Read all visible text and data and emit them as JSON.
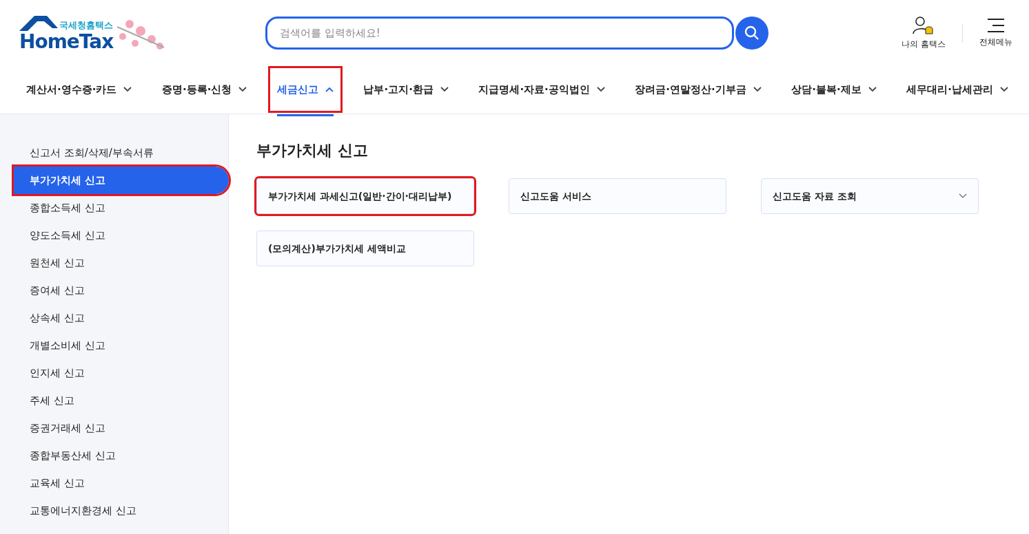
{
  "logo": {
    "subtitle": "국세청홈택스",
    "name": "HomeTax"
  },
  "search": {
    "placeholder": "검색어를 입력하세요!"
  },
  "utility": [
    {
      "kind": "my",
      "label": "나의 홈택스"
    },
    {
      "kind": "menu",
      "label": "전체메뉴"
    }
  ],
  "nav": [
    {
      "label": "계산서·영수증·카드",
      "selected": false,
      "highlighted": false
    },
    {
      "label": "증명·등록·신청",
      "selected": false,
      "highlighted": false
    },
    {
      "label": "세금신고",
      "selected": true,
      "highlighted": true
    },
    {
      "label": "납부·고지·환급",
      "selected": false,
      "highlighted": false
    },
    {
      "label": "지급명세·자료·공익법인",
      "selected": false,
      "highlighted": false
    },
    {
      "label": "장려금·연말정산·기부금",
      "selected": false,
      "highlighted": false
    },
    {
      "label": "상담·불복·제보",
      "selected": false,
      "highlighted": false
    },
    {
      "label": "세무대리·납세관리",
      "selected": false,
      "highlighted": false
    }
  ],
  "sidebar": {
    "items": [
      {
        "label": "신고서 조회/삭제/부속서류",
        "selected": false,
        "highlighted": false
      },
      {
        "label": "부가가치세 신고",
        "selected": true,
        "highlighted": true
      },
      {
        "label": "종합소득세 신고",
        "selected": false,
        "highlighted": false
      },
      {
        "label": "양도소득세 신고",
        "selected": false,
        "highlighted": false
      },
      {
        "label": "원천세 신고",
        "selected": false,
        "highlighted": false
      },
      {
        "label": "증여세 신고",
        "selected": false,
        "highlighted": false
      },
      {
        "label": "상속세 신고",
        "selected": false,
        "highlighted": false
      },
      {
        "label": "개별소비세 신고",
        "selected": false,
        "highlighted": false
      },
      {
        "label": "인지세 신고",
        "selected": false,
        "highlighted": false
      },
      {
        "label": "주세 신고",
        "selected": false,
        "highlighted": false
      },
      {
        "label": "증권거래세 신고",
        "selected": false,
        "highlighted": false
      },
      {
        "label": "종합부동산세 신고",
        "selected": false,
        "highlighted": false
      },
      {
        "label": "교육세 신고",
        "selected": false,
        "highlighted": false
      },
      {
        "label": "교통에너지환경세 신고",
        "selected": false,
        "highlighted": false
      }
    ]
  },
  "main": {
    "title": "부가가치세 신고",
    "cards": [
      {
        "label": "부가가치세 과세신고(일반·간이·대리납부)",
        "kind": "link",
        "highlighted": true
      },
      {
        "label": "신고도움 서비스",
        "kind": "link",
        "highlighted": false
      },
      {
        "label": "신고도움 자료 조회",
        "kind": "dropdown",
        "highlighted": false
      },
      {
        "label": "(모의계산)부가가치세 세액비교",
        "kind": "link",
        "highlighted": false
      }
    ]
  }
}
